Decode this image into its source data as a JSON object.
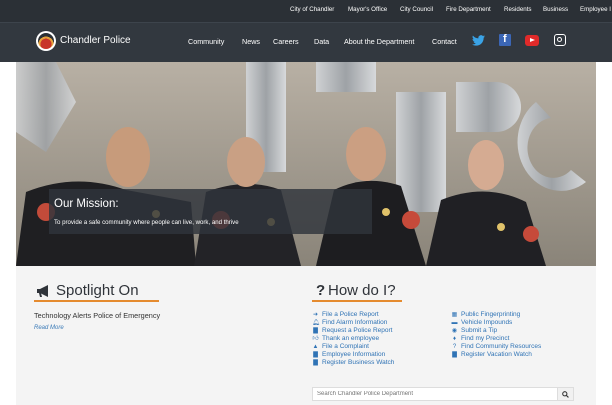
{
  "topbar": {
    "links": [
      "City of Chandler",
      "Mayor's Office",
      "City Council",
      "Fire Department",
      "Residents",
      "Business",
      "Employee I"
    ]
  },
  "nav": {
    "brand": "Chandler Police",
    "links": [
      "Community",
      "News",
      "Careers",
      "Data",
      "About the Department",
      "Contact"
    ],
    "social_icons": [
      "twitter-icon",
      "facebook-icon",
      "youtube-icon",
      "instagram-icon"
    ]
  },
  "hero": {
    "mission_title": "Our Mission:",
    "mission_text": "To provide a safe community where people can live, work, and thrive"
  },
  "spotlight": {
    "title": "Spotlight On",
    "icon": "megaphone-icon",
    "headline": "Technology Alerts Police of Emergency",
    "read_more": "Read More"
  },
  "how": {
    "title": "How do I?",
    "col1": [
      {
        "label": "File a Police Report",
        "icon": "arrow-right-icon"
      },
      {
        "label": "Find Alarm Information",
        "icon": "bell-icon"
      },
      {
        "label": "Request a Police Report",
        "icon": "document-icon"
      },
      {
        "label": "Thank an employee",
        "icon": "thumbs-up-icon"
      },
      {
        "label": "File a Complaint",
        "icon": "warning-icon"
      },
      {
        "label": "Employee Information",
        "icon": "document-icon"
      },
      {
        "label": "Register Business Watch",
        "icon": "document-icon"
      }
    ],
    "col2": [
      {
        "label": "Public Fingerprinting",
        "icon": "calendar-icon"
      },
      {
        "label": "Vehicle Impounds",
        "icon": "car-icon"
      },
      {
        "label": "Submit a Tip",
        "icon": "eye-icon"
      },
      {
        "label": "Find my Precinct",
        "icon": "map-marker-icon"
      },
      {
        "label": "Find Community Resources",
        "icon": "question-icon"
      },
      {
        "label": "Register Vacation Watch",
        "icon": "document-icon"
      }
    ]
  },
  "search": {
    "placeholder": "Search Chandler Police Department"
  },
  "colors": {
    "topbar": "#2b3036",
    "nav": "#32383f",
    "accent": "#e58b2f",
    "link": "#2f73b5"
  }
}
